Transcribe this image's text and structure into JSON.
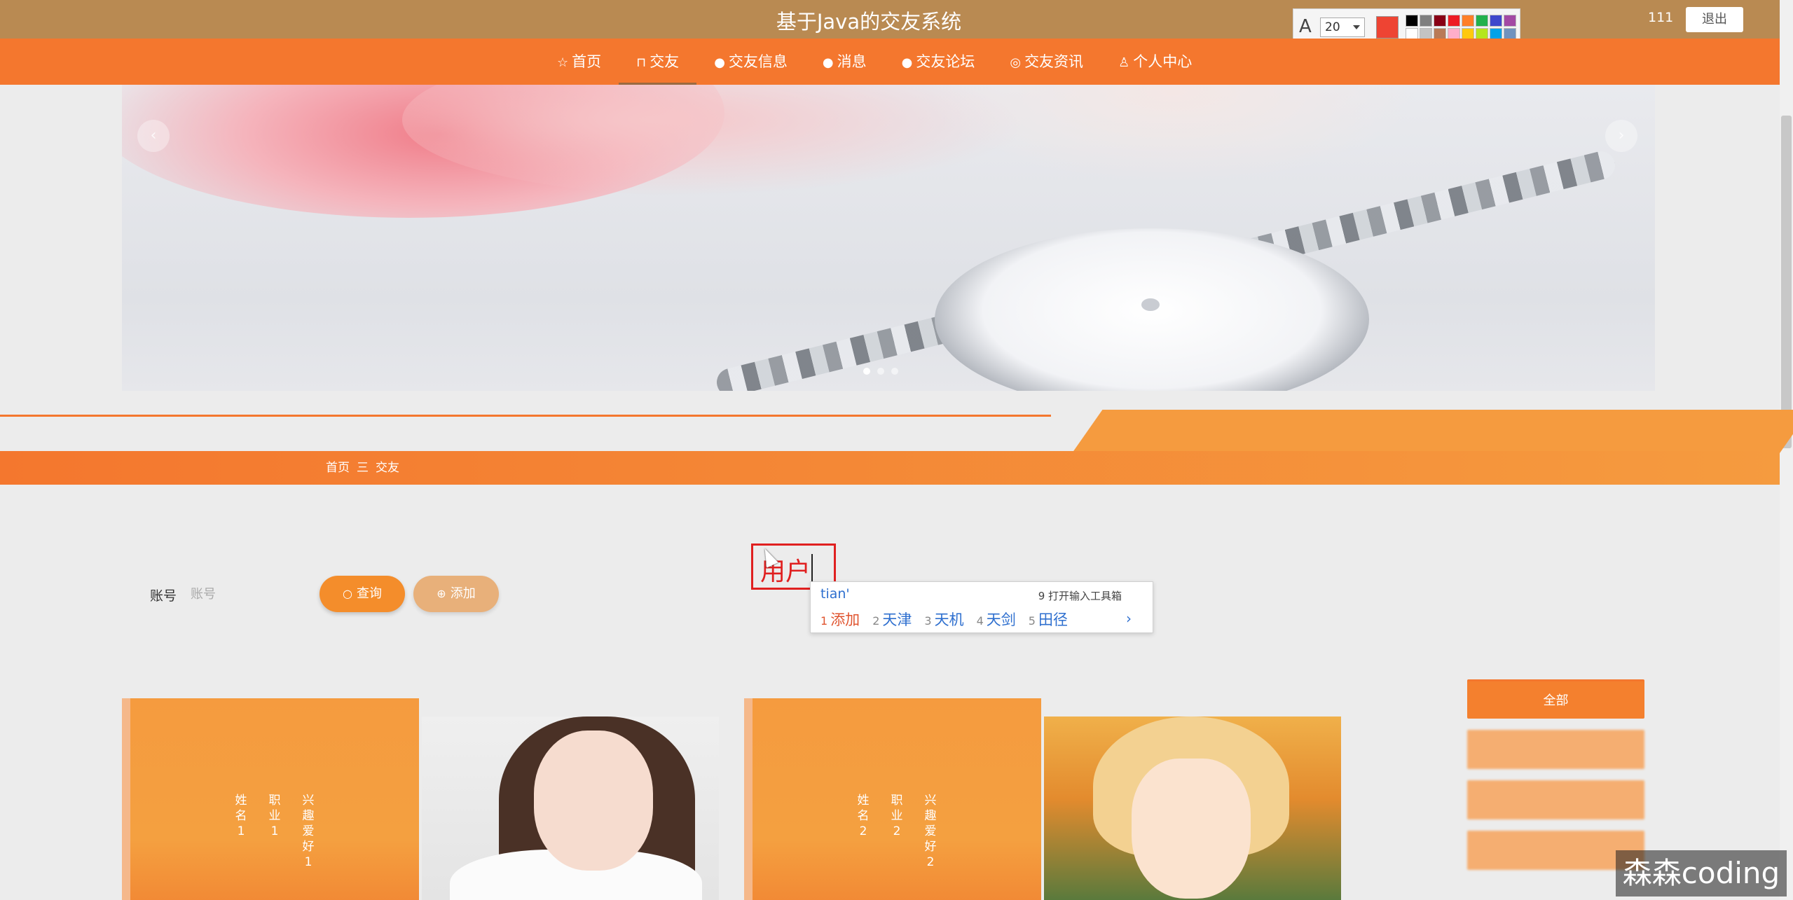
{
  "header": {
    "site_title": "基于Java的交友系统",
    "user_name": "111",
    "logout_label": "退出"
  },
  "annotation_toolbar": {
    "font_size_value": "20",
    "current_color": "#ee4433",
    "palette": [
      "#000000",
      "#7f7f7f",
      "#880015",
      "#ed1c24",
      "#ff7f27",
      "#22b14c",
      "#3f48cc",
      "#a349a4",
      "#ffffff",
      "#c3c3c3",
      "#b97a57",
      "#ffaec9",
      "#ffc90e",
      "#b5e61d",
      "#00a2e8",
      "#7092be"
    ]
  },
  "nav": {
    "items": [
      {
        "label": "首页",
        "icon": "star-icon",
        "glyph": "☆"
      },
      {
        "label": "交友",
        "icon": "bag-icon",
        "glyph": "⊓"
      },
      {
        "label": "交友信息",
        "icon": "info-icon",
        "glyph": "●"
      },
      {
        "label": "消息",
        "icon": "question-icon",
        "glyph": "●"
      },
      {
        "label": "交友论坛",
        "icon": "info-circle-icon",
        "glyph": "●"
      },
      {
        "label": "交友资讯",
        "icon": "globe-icon",
        "glyph": "◎"
      },
      {
        "label": "个人中心",
        "icon": "user-icon",
        "glyph": "♙"
      }
    ],
    "active_index": 1
  },
  "banner": {
    "prev_glyph": "‹",
    "next_glyph": "›",
    "slide_count": 3,
    "active_slide": 0
  },
  "breadcrumb": {
    "home": "首页",
    "separator": "三",
    "current": "交友"
  },
  "search": {
    "label": "账号",
    "placeholder": "账号",
    "query_label": "查询",
    "add_label": "添加"
  },
  "annotation": {
    "text": "用户"
  },
  "ime": {
    "input": "tian'",
    "tool_label": "9 打开输入工具箱",
    "candidates": [
      {
        "n": "1",
        "text": "添加"
      },
      {
        "n": "2",
        "text": "天津"
      },
      {
        "n": "3",
        "text": "天机"
      },
      {
        "n": "4",
        "text": "天剑"
      },
      {
        "n": "5",
        "text": "田径"
      }
    ],
    "next_glyph": "›"
  },
  "cards": [
    {
      "name": "姓名1",
      "job": "职业1",
      "hobby": "兴趣爱好1"
    },
    {
      "name": "姓名2",
      "job": "职业2",
      "hobby": "兴趣爱好2"
    }
  ],
  "categories": {
    "all_label": "全部"
  },
  "watermark": "森森coding",
  "colors": {
    "nav_orange": "#f4772e",
    "accent_orange": "#f59b3f",
    "title_bar": "#b98a52",
    "annotation_red": "#e02020"
  }
}
